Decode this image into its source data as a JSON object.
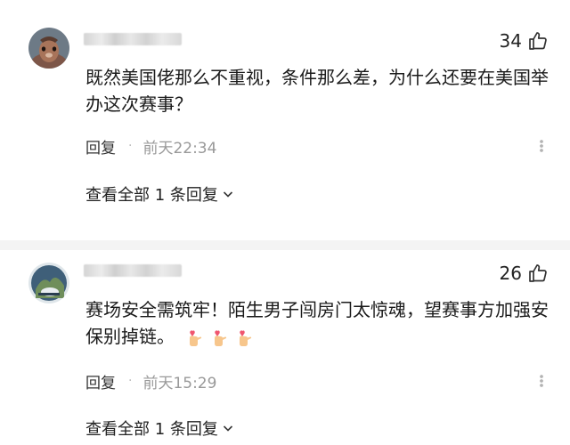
{
  "comments": [
    {
      "likes": "34",
      "text": "既然美国佬那么不重视，条件那么差，为什么还要在美国举办这次赛事？",
      "reply_label": "回复",
      "separator": "·",
      "time": "前天22:34",
      "view_replies": "查看全部 1 条回复"
    },
    {
      "likes": "26",
      "text": "赛场安全需筑牢！陌生男子闯房门太惊魂，望赛事方加强安保别掉链。",
      "reply_label": "回复",
      "separator": "·",
      "time": "前天15:29",
      "view_replies": "查看全部 1 条回复"
    }
  ],
  "icons": {
    "like": "thumbs-up-icon",
    "more": "more-dots-icon",
    "expand": "chevron-down-icon",
    "emoji": "finger-heart-emoji"
  },
  "colors": {
    "time_text": "#999999",
    "divider": "#f4f4f4"
  }
}
